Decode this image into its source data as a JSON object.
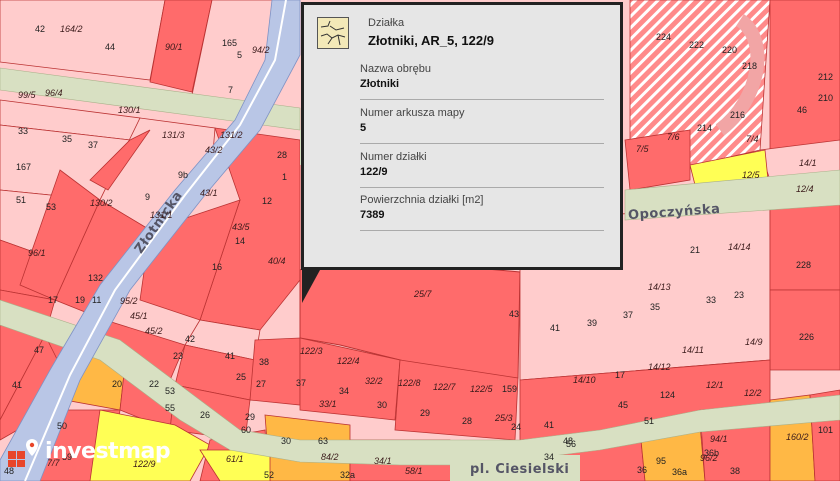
{
  "popup": {
    "type_label": "Działka",
    "title": "Złotniki, AR_5, 122/9",
    "fields": [
      {
        "key": "Nazwa obrębu",
        "value": "Złotniki"
      },
      {
        "key": "Numer arkusza mapy",
        "value": "5"
      },
      {
        "key": "Numer działki",
        "value": "122/9"
      },
      {
        "key": "Powierzchnia działki [m2]",
        "value": "7389"
      }
    ]
  },
  "streets": [
    "Złotnicka",
    "Opoczyńska",
    "pl. Ciesielski"
  ],
  "parcel_labels": [
    "42",
    "164/2",
    "44",
    "90/1",
    "165",
    "5",
    "94/2",
    "7",
    "99/5",
    "96/4",
    "130/1",
    "131/3",
    "131/2",
    "43/2",
    "28",
    "1",
    "33",
    "35",
    "37",
    "167",
    "9b",
    "130/2",
    "9",
    "131/1",
    "51",
    "53",
    "12",
    "43/1",
    "43/5",
    "14",
    "16",
    "40/4",
    "96/1",
    "132",
    "17",
    "19",
    "11",
    "95/2",
    "45/1",
    "45/2",
    "42",
    "23",
    "41",
    "25",
    "27",
    "38",
    "122/3",
    "122/4",
    "37",
    "34",
    "32/2",
    "122/8",
    "122/7",
    "122/5",
    "159",
    "47",
    "20",
    "22",
    "53",
    "55",
    "26",
    "29",
    "33/1",
    "30",
    "29",
    "28",
    "25/3",
    "24",
    "41",
    "48",
    "50",
    "59",
    "60",
    "30",
    "63",
    "84/2",
    "32a",
    "34/1",
    "58/1",
    "61/1",
    "52",
    "122/9",
    "25/7",
    "43",
    "41",
    "39",
    "37",
    "35",
    "33",
    "23",
    "21",
    "14/14",
    "14/13",
    "14/12",
    "14/11",
    "14/9",
    "14/10",
    "17",
    "45",
    "124",
    "51",
    "12/1",
    "12/2",
    "14/1",
    "12/4",
    "12/5",
    "228",
    "226",
    "224",
    "222",
    "220",
    "218",
    "216",
    "214",
    "7/6",
    "7/5",
    "7/4",
    "212",
    "210",
    "46",
    "34",
    "36",
    "95",
    "36a",
    "36b",
    "94/1",
    "96/2",
    "38",
    "101",
    "160/2",
    "41",
    "56",
    "48",
    "7/7"
  ],
  "logo": {
    "text": "investmap"
  },
  "colors": {
    "building_parcel": "#ff6b6b",
    "light_parcel": "#ffcccc",
    "road": "#d8e0c2",
    "water": "#b9c6e6",
    "yellow_parcel": "#ffff55",
    "orange_parcel": "#ffb845",
    "popup_bg": "#e6e6e6"
  }
}
